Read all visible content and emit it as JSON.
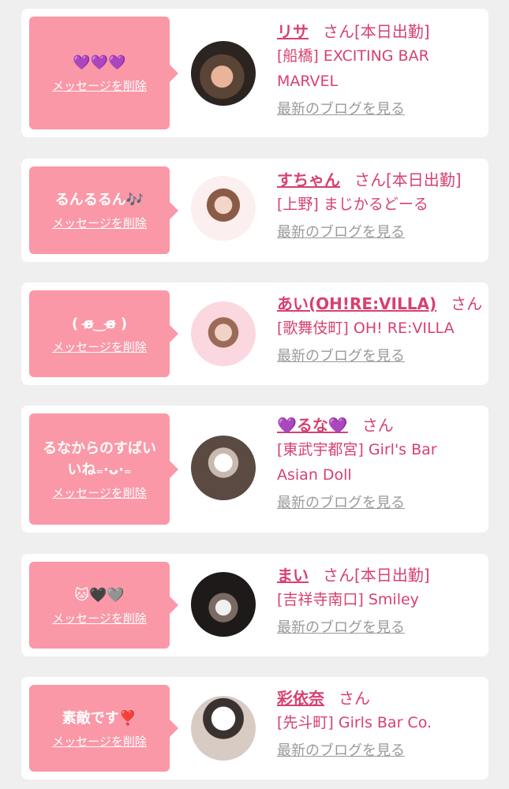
{
  "delete_label": "メッセージを削除",
  "blog_label": "最新のブログを見る",
  "san_label": "さん",
  "colors": {
    "background": "#efefef",
    "bubble": "#fa98a8",
    "accent": "#d7416f",
    "link_gray": "#9a9a9a"
  },
  "messages": [
    {
      "message": "💜💜💜",
      "name": "リサ",
      "status": "[本日出勤]",
      "shop_lines": [
        "[船橋] EXCITING BAR",
        "MARVEL"
      ]
    },
    {
      "message": "るんるるん🎶",
      "name": "すちゃん",
      "status": "[本日出勤]",
      "shop_lines": [
        "[上野] まじかるどーる"
      ]
    },
    {
      "message": "( ɞ̴̶̷‿ɞ̴̶̷ )",
      "name": "あい(OH!RE:VILLA)",
      "status": "",
      "shop_lines": [
        "[歌舞伎町] OH! RE:VILLA"
      ]
    },
    {
      "message": "るなからのすばいいね₌·ᴗ·₌",
      "name": "💜るな💜",
      "status": "",
      "shop_lines": [
        "[東武宇都宮] Girl's Bar",
        "Asian Doll"
      ]
    },
    {
      "message": "🐱🖤🩶",
      "name": "まい",
      "status": "[本日出勤]",
      "shop_lines": [
        "[吉祥寺南口] Smiley"
      ]
    },
    {
      "message": "素敵です❣️",
      "name": "彩依奈",
      "status": "",
      "shop_lines": [
        "[先斗町] Girls Bar Co."
      ]
    }
  ]
}
